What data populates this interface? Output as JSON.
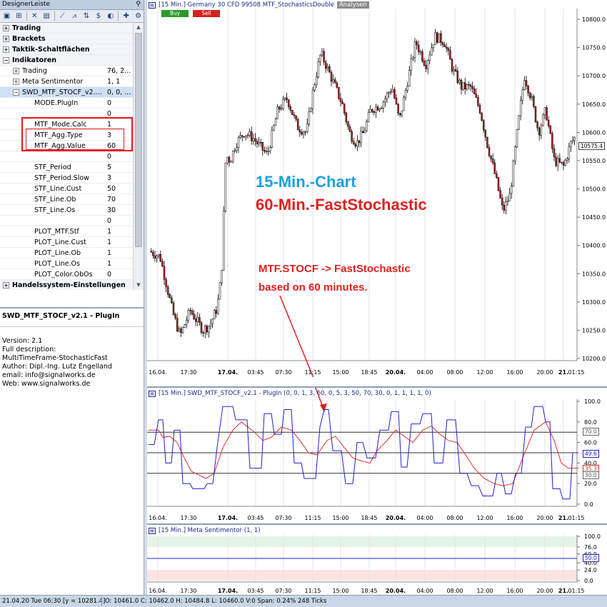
{
  "panel": {
    "title": "DesignerLeiste",
    "pin": "⚲",
    "toolbar": [
      "▣",
      "⊞",
      "✕",
      "▤",
      "⟋",
      "⩘",
      "⇅",
      "$",
      "◐",
      "✚",
      "⚙"
    ],
    "tree": [
      {
        "kind": "cat",
        "exp": "+",
        "name": "Trading",
        "value": "",
        "indent": 0
      },
      {
        "kind": "cat",
        "exp": "+",
        "name": "Brackets",
        "value": "",
        "indent": 0
      },
      {
        "kind": "cat",
        "exp": "+",
        "name": "Taktik-Schaltflächen",
        "value": "",
        "indent": 0
      },
      {
        "kind": "cat",
        "exp": "−",
        "name": "Indikatoren",
        "value": "",
        "indent": 0
      },
      {
        "kind": "item",
        "exp": "+",
        "name": "Trading",
        "value": "76, 2...",
        "indent": 1
      },
      {
        "kind": "item",
        "exp": "+",
        "name": "Meta Sentimentor",
        "value": "1, 1",
        "indent": 1
      },
      {
        "kind": "sel",
        "exp": "−",
        "name": "SWD_MTF_STOCF_v2....",
        "value": "0, 0, ...",
        "indent": 1
      },
      {
        "kind": "param",
        "exp": "",
        "name": "MODE.PlugIn",
        "value": "0",
        "indent": 2
      },
      {
        "kind": "param",
        "exp": "",
        "name": "",
        "value": "0",
        "indent": 2
      },
      {
        "kind": "param",
        "exp": "",
        "name": "MTF_Mode.Calc",
        "value": "1",
        "indent": 2
      },
      {
        "kind": "param",
        "exp": "",
        "name": "MTF_Agg.Type",
        "value": "3",
        "indent": 2
      },
      {
        "kind": "param",
        "exp": "",
        "name": "MTF_Agg.Value",
        "value": "60",
        "indent": 2
      },
      {
        "kind": "param",
        "exp": "",
        "name": "",
        "value": "0",
        "indent": 2
      },
      {
        "kind": "param",
        "exp": "",
        "name": "STF_Period",
        "value": "5",
        "indent": 2
      },
      {
        "kind": "param",
        "exp": "",
        "name": "STF_Period.Slow",
        "value": "3",
        "indent": 2
      },
      {
        "kind": "param",
        "exp": "",
        "name": "STF_Line.Cust",
        "value": "50",
        "indent": 2
      },
      {
        "kind": "param",
        "exp": "",
        "name": "STF_Line.Ob",
        "value": "70",
        "indent": 2
      },
      {
        "kind": "param",
        "exp": "",
        "name": "STF_Line.Os",
        "value": "30",
        "indent": 2
      },
      {
        "kind": "param",
        "exp": "",
        "name": "",
        "value": "0",
        "indent": 2
      },
      {
        "kind": "param",
        "exp": "",
        "name": "PLOT_MTF.Stf",
        "value": "1",
        "indent": 2
      },
      {
        "kind": "param",
        "exp": "",
        "name": "PLOT_Line.Cust",
        "value": "1",
        "indent": 2
      },
      {
        "kind": "param",
        "exp": "",
        "name": "PLOT_Line.Ob",
        "value": "1",
        "indent": 2
      },
      {
        "kind": "param",
        "exp": "",
        "name": "PLOT_Line.Os",
        "value": "1",
        "indent": 2
      },
      {
        "kind": "param",
        "exp": "",
        "name": "PLOT_Color.ObOs",
        "value": "0",
        "indent": 2
      },
      {
        "kind": "cat",
        "exp": "+",
        "name": "Handelssystem-Einstellungen",
        "value": "",
        "indent": 0
      }
    ],
    "desc_title": "SWD_MTF_STOCF_v2.1 - PlugIn",
    "desc_lines": [
      "",
      "Version: 2.1",
      "Full description:",
      "MultiTimeFrame-StochasticFast",
      "Author: Dipl.-Ing. Lutz Engelland",
      "email: info@signalworks.de",
      "Web: www.signalworks.de"
    ]
  },
  "price_pane": {
    "header": "[15 Min.] Germany 30 CFD   99508 MTF_StochasticsDouble",
    "analysen": "Analysen",
    "buy": "Buy",
    "sell": "Sell",
    "y_labels": [
      "10800.0",
      "10750.0",
      "10700.0",
      "10650.0",
      "10600.0",
      "10550.0",
      "10500.0",
      "10450.0",
      "10400.0",
      "10350.0",
      "10300.0",
      "10250.0",
      "10200.0"
    ],
    "current_price": "10575.4",
    "annotations": {
      "line1": "15-Min.-Chart",
      "line2": "60-Min.-FastStochastic",
      "line3": "MTF.STOCF -> FastStochastic",
      "line4": "based on 60 minutes."
    }
  },
  "x_labels": [
    "16.04.",
    "17:30",
    "17.04.",
    "03:45",
    "07:30",
    "11:15",
    "15:00",
    "18:45",
    "20.04.",
    "04:00",
    "08:00",
    "12:00",
    "16:00",
    "20:00",
    "21.",
    "01:15"
  ],
  "stoch_pane": {
    "header": "[15 Min.] SWD_MTF_STOCF_v2.1 - PlugIn  (0, 0, 1, 3, 60, 0, 5, 3, 50, 70, 30, 0, 1, 1, 1, 1, 0)",
    "y_labels": [
      "100.0",
      "80.0",
      "60.0",
      "40.0",
      "20.0",
      "0.0"
    ],
    "tag_70": "70.0",
    "tag_blue": "49.6",
    "tag_red": "35.3",
    "tag_30": "30.0"
  },
  "meta_pane": {
    "header": "[15 Min.] Meta Sentimentor  (1, 1)",
    "y_labels": [
      "100.0",
      "76.0",
      "60.0",
      "40.0",
      "24.0",
      "0.0"
    ],
    "tag_50": "50.0"
  },
  "status": {
    "datetime": "21.04.20 Tue  06:30 [y = 10281.4]",
    "ohlc": "O: 10461.0 C: 10462.0 H: 10484.8 L: 10460.0 V:0 Span: 0.24% 248 Ticks"
  },
  "colors": {
    "up_candle": "#ffffff",
    "down_candle": "#b22222",
    "stoch_fast": "#2020d0",
    "stoch_slow": "#e03030",
    "annotation_blue": "#1da0e0",
    "annotation_red": "#e02020"
  }
}
